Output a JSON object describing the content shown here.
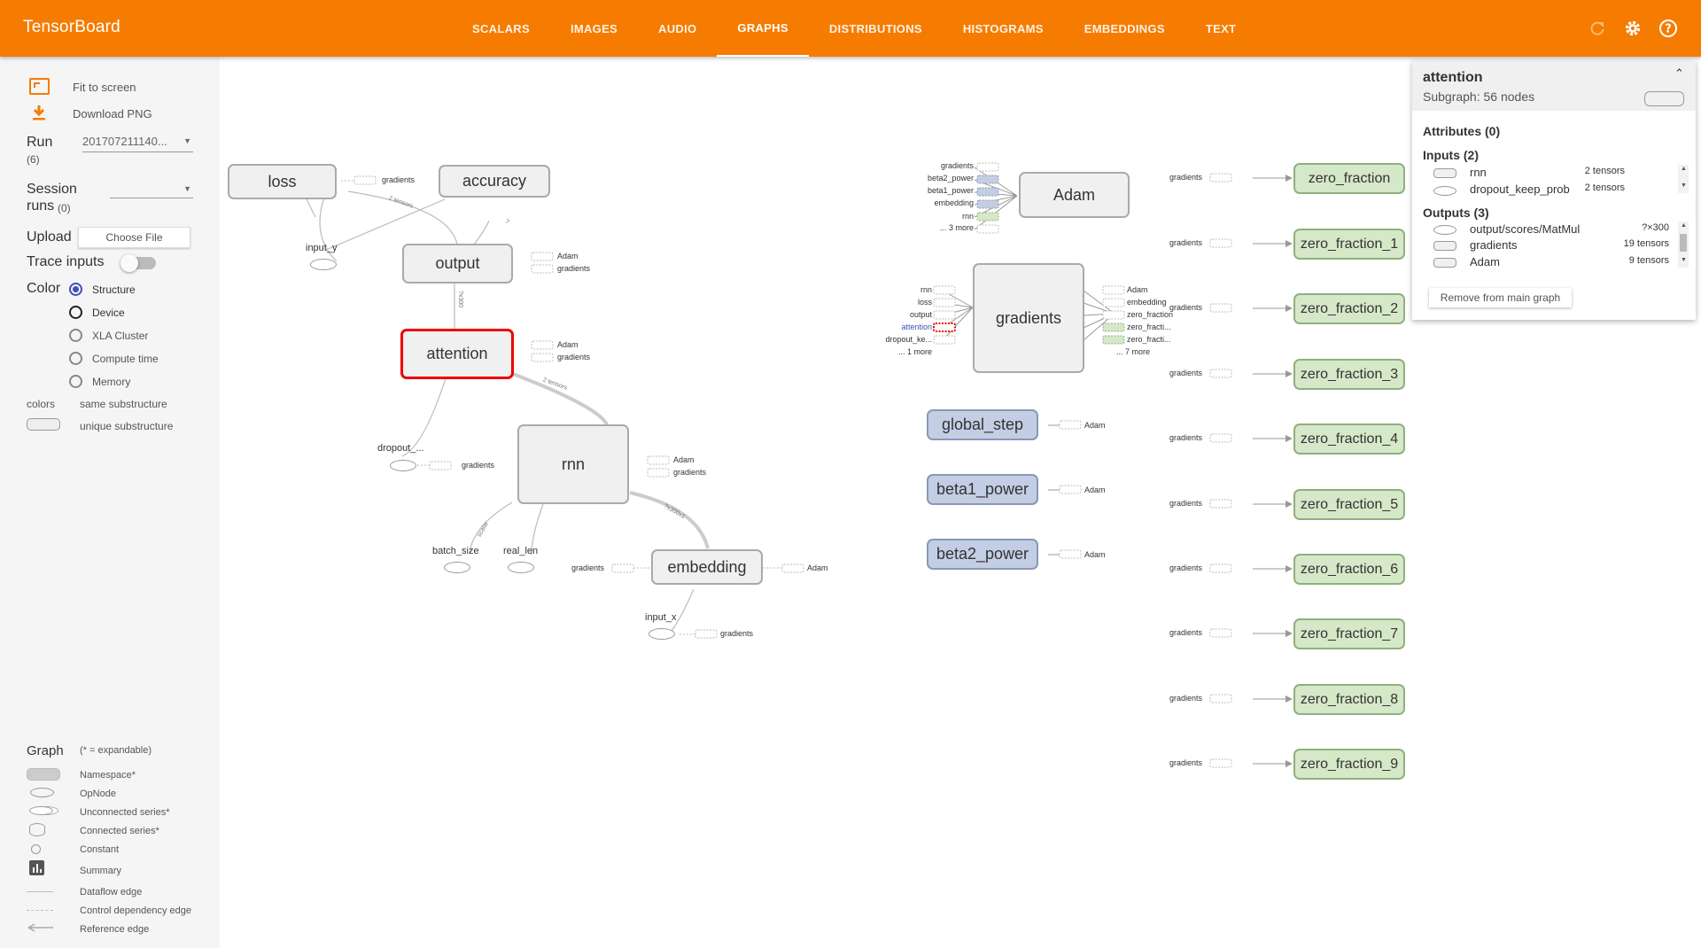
{
  "app": {
    "title": "TensorBoard"
  },
  "tabs": [
    {
      "label": "SCALARS"
    },
    {
      "label": "IMAGES"
    },
    {
      "label": "AUDIO"
    },
    {
      "label": "GRAPHS"
    },
    {
      "label": "DISTRIBUTIONS"
    },
    {
      "label": "HISTOGRAMS"
    },
    {
      "label": "EMBEDDINGS"
    },
    {
      "label": "TEXT"
    }
  ],
  "sidebar": {
    "fit_label": "Fit to screen",
    "download_label": "Download PNG",
    "run_label": "Run",
    "run_count": "(6)",
    "run_value": "201707211140...",
    "session_label": "Session",
    "session_label2": "runs",
    "session_count": "(0)",
    "upload_label": "Upload",
    "choose_file": "Choose File",
    "trace_label": "Trace inputs",
    "color_label": "Color",
    "color_options": [
      "Structure",
      "Device",
      "XLA Cluster",
      "Compute time",
      "Memory"
    ],
    "colors_label": "colors",
    "same_sub": "same substructure",
    "unique_sub": "unique substructure",
    "legend_title": "Graph",
    "legend_note": "(* = expandable)",
    "legend": [
      "Namespace*",
      "OpNode",
      "Unconnected series*",
      "Connected series*",
      "Constant",
      "Summary",
      "Dataflow edge",
      "Control dependency edge",
      "Reference edge"
    ]
  },
  "graph": {
    "loss": "loss",
    "accuracy": "accuracy",
    "output": "output",
    "attention": "attention",
    "rnn": "rnn",
    "embedding": "embedding",
    "input_y": "input_y",
    "dropout": "dropout_...",
    "batch_size": "batch_size",
    "real_len": "real_len",
    "input_x": "input_x",
    "adam": "Adam",
    "gradients": "gradients",
    "global_step": "global_step",
    "beta1_power": "beta1_power",
    "beta2_power": "beta2_power",
    "zero_fractions": [
      "zero_fraction",
      "zero_fraction_1",
      "zero_fraction_2",
      "zero_fraction_3",
      "zero_fraction_4",
      "zero_fraction_5",
      "zero_fraction_6",
      "zero_fraction_7",
      "zero_fraction_8",
      "zero_fraction_9"
    ],
    "lbl_gradients": "gradients",
    "lbl_adam": "Adam",
    "adam_inputs": [
      "gradients",
      "beta2_power",
      "beta1_power",
      "embedding",
      "rnn",
      "... 3 more"
    ],
    "grad_inputs": [
      "rnn",
      "loss",
      "output",
      "attention",
      "dropout_ke...",
      "... 1 more"
    ],
    "grad_outputs": [
      "Adam",
      "embedding",
      "zero_fraction",
      "zero_fracti...",
      "zero_fracti...",
      "... 7 more"
    ],
    "edge_labels": {
      "e1": "2 tensors",
      "e2": "?x300",
      "e3": "2 tensors",
      "e4": "scalar",
      "e5": "?x300x1",
      "e6": "?"
    }
  },
  "info": {
    "title": "attention",
    "subtitle": "Subgraph: 56 nodes",
    "attributes": "Attributes (0)",
    "inputs": "Inputs (2)",
    "input_items": [
      {
        "name": "rnn",
        "count": "2 tensors"
      },
      {
        "name": "dropout_keep_prob",
        "count": "2 tensors"
      }
    ],
    "outputs": "Outputs (3)",
    "output_items": [
      {
        "name": "output/scores/MatMul",
        "count": "?×300"
      },
      {
        "name": "gradients",
        "count": "19 tensors"
      },
      {
        "name": "Adam",
        "count": "9 tensors"
      }
    ],
    "remove_btn": "Remove from main graph"
  }
}
